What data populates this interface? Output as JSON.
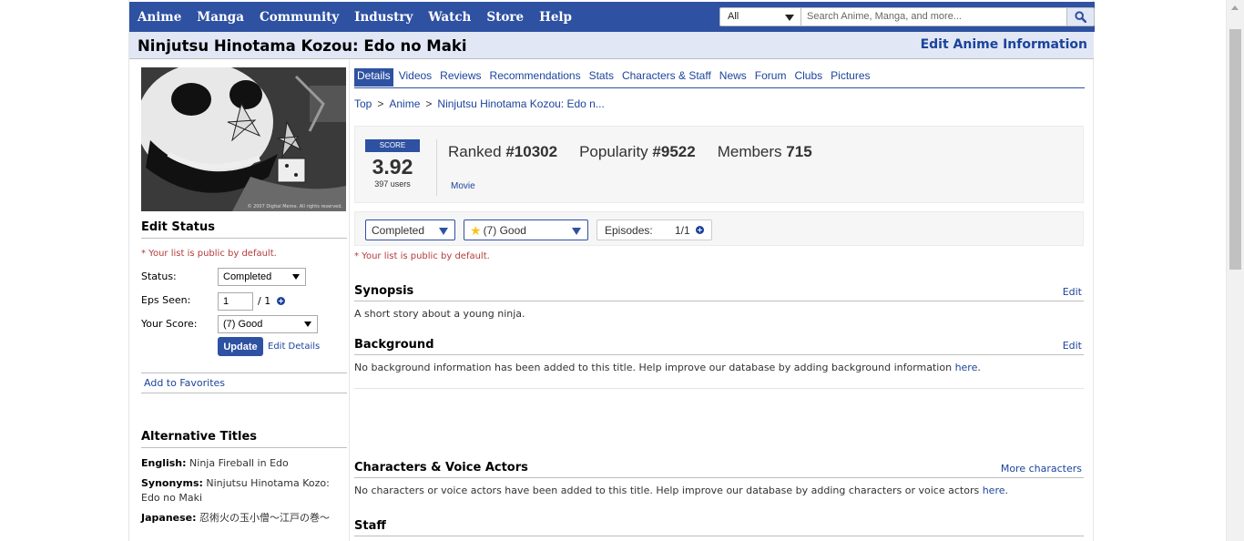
{
  "nav": {
    "items": [
      "Anime",
      "Manga",
      "Community",
      "Industry",
      "Watch",
      "Store",
      "Help"
    ],
    "search_category": "All",
    "search_placeholder": "Search Anime, Manga, and more..."
  },
  "title": {
    "text": "Ninjutsu Hinotama Kozou: Edo no Maki",
    "edit_label": "Edit Anime Information"
  },
  "cover": {
    "copyright": "© 2007 Digital Meme. All rights reserved."
  },
  "edit_status": {
    "heading": "Edit Status",
    "public_note": "* Your list is public by default.",
    "status_label": "Status:",
    "status_value": "Completed",
    "eps_label": "Eps Seen:",
    "eps_value": "1",
    "eps_total": "/ 1",
    "score_label": "Your Score:",
    "score_value": "(7) Good",
    "update_label": "Update",
    "edit_details_label": "Edit Details",
    "favorites_label": "Add to Favorites"
  },
  "alt_titles": {
    "heading": "Alternative Titles",
    "english_label": "English:",
    "english_value": "Ninja Fireball in Edo",
    "synonyms_label": "Synonyms:",
    "synonyms_value": "Ninjutsu Hinotama Kozo: Edo no Maki",
    "japanese_label": "Japanese:",
    "japanese_value": "忍術火の玉小僧〜江戸の巻〜"
  },
  "tabs": [
    "Details",
    "Videos",
    "Reviews",
    "Recommendations",
    "Stats",
    "Characters & Staff",
    "News",
    "Forum",
    "Clubs",
    "Pictures"
  ],
  "breadcrumb": [
    "Top",
    "Anime",
    "Ninjutsu Hinotama Kozou: Edo n..."
  ],
  "stats": {
    "score_label": "SCORE",
    "score_value": "3.92",
    "score_users": "397 users",
    "ranked_label": "Ranked",
    "ranked_value": "#10302",
    "popularity_label": "Popularity",
    "popularity_value": "#9522",
    "members_label": "Members",
    "members_value": "715",
    "media_type": "Movie"
  },
  "list_bar": {
    "status": "Completed",
    "score": "(7) Good",
    "episodes_label": "Episodes:",
    "episodes_value": "1/1",
    "public_note": "* Your list is public by default."
  },
  "synopsis": {
    "heading": "Synopsis",
    "edit": "Edit",
    "text": "A short story about a young ninja."
  },
  "background": {
    "heading": "Background",
    "edit": "Edit",
    "text": "No background information has been added to this title. Help improve our database by adding background information",
    "link": "here"
  },
  "characters": {
    "heading": "Characters & Voice Actors",
    "more": "More characters",
    "text": "No characters or voice actors have been added to this title. Help improve our database by adding characters or voice actors",
    "link": "here"
  },
  "staff": {
    "heading": "Staff"
  },
  "colors": {
    "brand": "#2e51a2",
    "title_bg": "#e1e7f5",
    "link": "#1c439b",
    "note": "#b43b3b"
  }
}
